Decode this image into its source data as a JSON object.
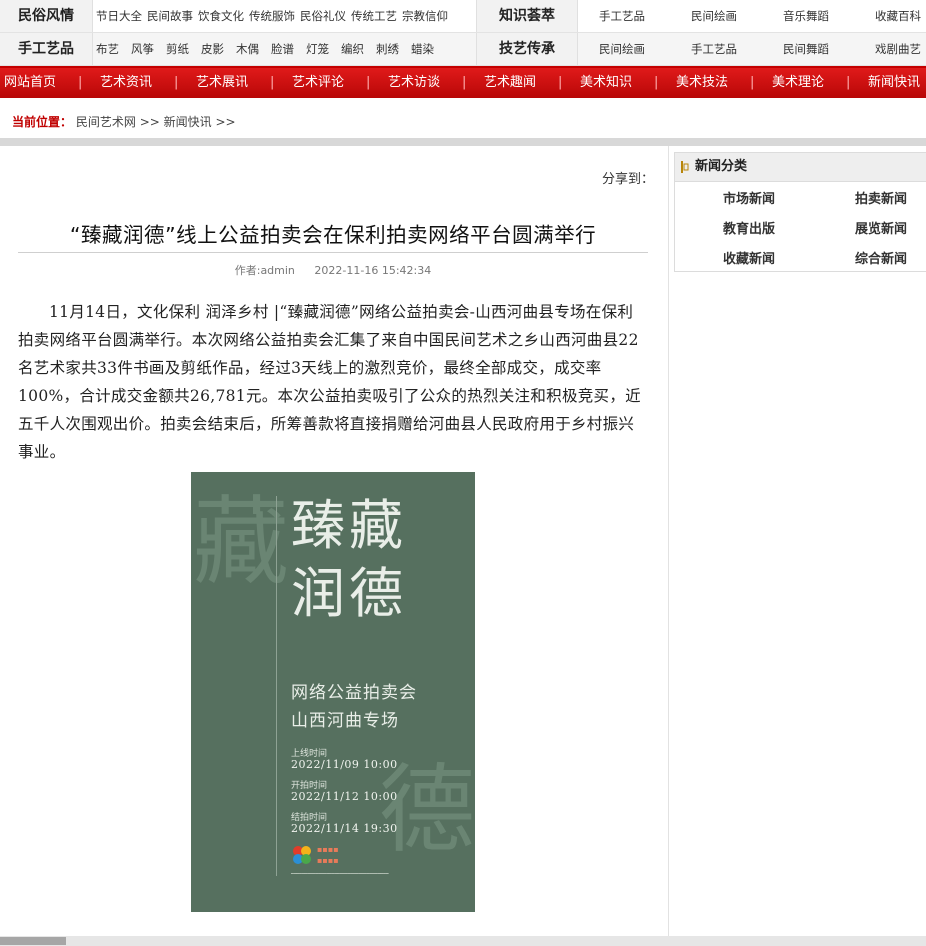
{
  "topnav": {
    "row1": {
      "title": "民俗风情",
      "links": [
        "节日大全",
        "民间故事",
        "饮食文化",
        "传统服饰",
        "民俗礼仪",
        "传统工艺",
        "宗教信仰"
      ],
      "section": "知识荟萃",
      "right": [
        "手工艺品",
        "民间绘画",
        "音乐舞蹈",
        "收藏百科"
      ]
    },
    "row2": {
      "title": "手工艺品",
      "links": [
        "布艺",
        "风筝",
        "剪纸",
        "皮影",
        "木偶",
        "脸谱",
        "灯笼",
        "编织",
        "刺绣",
        "蜡染"
      ],
      "section": "技艺传承",
      "right": [
        "民间绘画",
        "手工艺品",
        "民间舞蹈",
        "戏剧曲艺"
      ]
    }
  },
  "mainnav": [
    "网站首页",
    "艺术资讯",
    "艺术展讯",
    "艺术评论",
    "艺术访谈",
    "艺术趣闻",
    "美术知识",
    "美术技法",
    "美术理论",
    "新闻快讯"
  ],
  "breadcrumb": {
    "label": "当前位置：",
    "items": [
      "民间艺术网",
      ">>",
      "新闻快讯",
      ">>"
    ]
  },
  "article": {
    "share_label": "分享到：",
    "title": "“臻藏润德”线上公益拍卖会在保利拍卖网络平台圆满举行",
    "author": "作者:admin",
    "date": "2022-11-16 15:42:34",
    "body": "11月14日，文化保利 润泽乡村 |“臻藏润德”网络公益拍卖会-山西河曲县专场在保利拍卖网络平台圆满举行。本次网络公益拍卖会汇集了来自中国民间艺术之乡山西河曲县22名艺术家共33件书画及剪纸作品，经过3天线上的激烈竞价，最终全部成交，成交率100%，合计成交金额共26,781元。本次公益拍卖吸引了公众的热烈关注和积极竞买，近五千人次围观出价。拍卖会结束后，所筹善款将直接捐赠给河曲县人民政府用于乡村振兴事业。"
  },
  "poster": {
    "bg_color": "#56705f",
    "watermark_top": "藏",
    "watermark_bottom": "德",
    "title_line1": "臻藏",
    "title_line2": "润德",
    "subtitle1": "网络公益拍卖会",
    "subtitle2": "山西河曲专场",
    "label_online": "上线时间",
    "date_online": "2022/11/09 10:00",
    "label_start": "开拍时间",
    "date_start": "2022/11/12 10:00",
    "label_end": "结拍时间",
    "date_end": "2022/11/14 19:30"
  },
  "sidebar": {
    "title": "新闻分类",
    "items": [
      "市场新闻",
      "拍卖新闻",
      "教育出版",
      "展览新闻",
      "收藏新闻",
      "综合新闻"
    ]
  },
  "colors": {
    "nav_red": "#d01010",
    "accent_red": "#c00000",
    "poster_green": "#56705f"
  }
}
